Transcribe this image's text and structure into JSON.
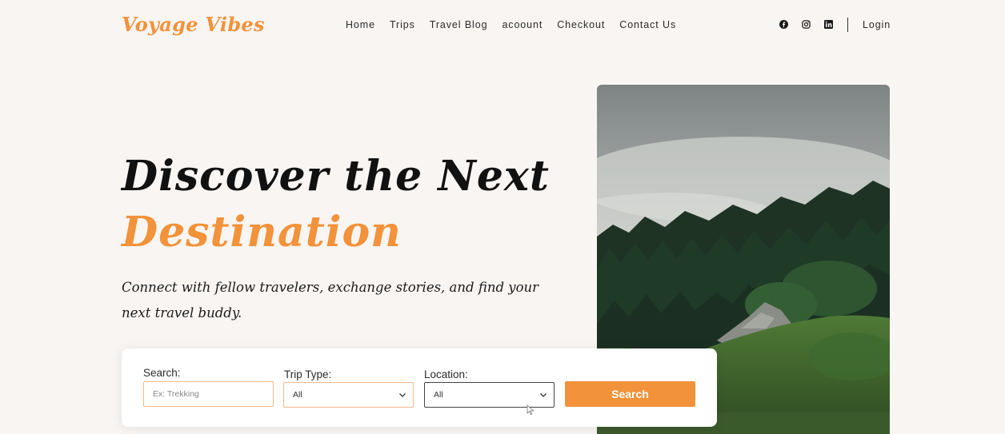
{
  "brand": {
    "logo": "Voyage Vibes",
    "accent_color": "#f2923a"
  },
  "nav": {
    "items": [
      {
        "label": "Home"
      },
      {
        "label": "Trips"
      },
      {
        "label": "Travel Blog"
      },
      {
        "label": "acoount"
      },
      {
        "label": "Checkout"
      },
      {
        "label": "Contact Us"
      }
    ],
    "social_icons": [
      "facebook-icon",
      "instagram-icon",
      "linkedin-icon"
    ],
    "login": "Login"
  },
  "hero": {
    "title_line1": "Discover the Next",
    "title_line2": "Destination",
    "tagline": "Connect with fellow travelers, exchange stories, and find your next travel buddy."
  },
  "search": {
    "search_label": "Search:",
    "search_placeholder": "Ex: Trekking",
    "trip_type_label": "Trip Type:",
    "trip_type_value": "All",
    "location_label": "Location:",
    "location_value": "All",
    "button_label": "Search"
  }
}
